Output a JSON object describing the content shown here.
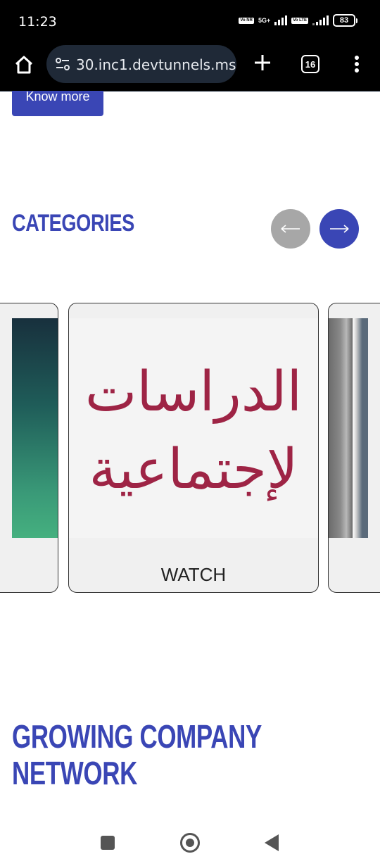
{
  "status_bar": {
    "time": "11:23",
    "sim1_tag": "Vo NR",
    "sim1_network": "5G+",
    "sim2_tag": "Vo LTE",
    "battery": "83"
  },
  "browser": {
    "url": "30.inc1.devtunnels.ms",
    "tab_count": "16",
    "icons": [
      "home-icon",
      "site-settings-icon",
      "plus-icon",
      "tabs-icon",
      "more-vert-icon"
    ]
  },
  "page": {
    "know_more_label": "Know more",
    "categories_title": "CATEGORIES",
    "prev_arrow": "⟵",
    "next_arrow": "⟶",
    "carousel": {
      "center_card": {
        "image_text_line1": "الدراسات",
        "image_text_line2": "لإجتماعية",
        "label": "WATCH"
      }
    },
    "growing_title_line1": "GROWING COMPANY",
    "growing_title_line2": "NETWORK"
  },
  "colors": {
    "accent": "#3a46b5",
    "arrow_disabled": "#a7a7a7",
    "arabic_text": "#9e2445",
    "browser_bg": "#000000",
    "url_pill": "#1f2937"
  },
  "nav_bar": {
    "icons": [
      "recents-square-icon",
      "home-circle-icon",
      "back-triangle-icon"
    ]
  }
}
